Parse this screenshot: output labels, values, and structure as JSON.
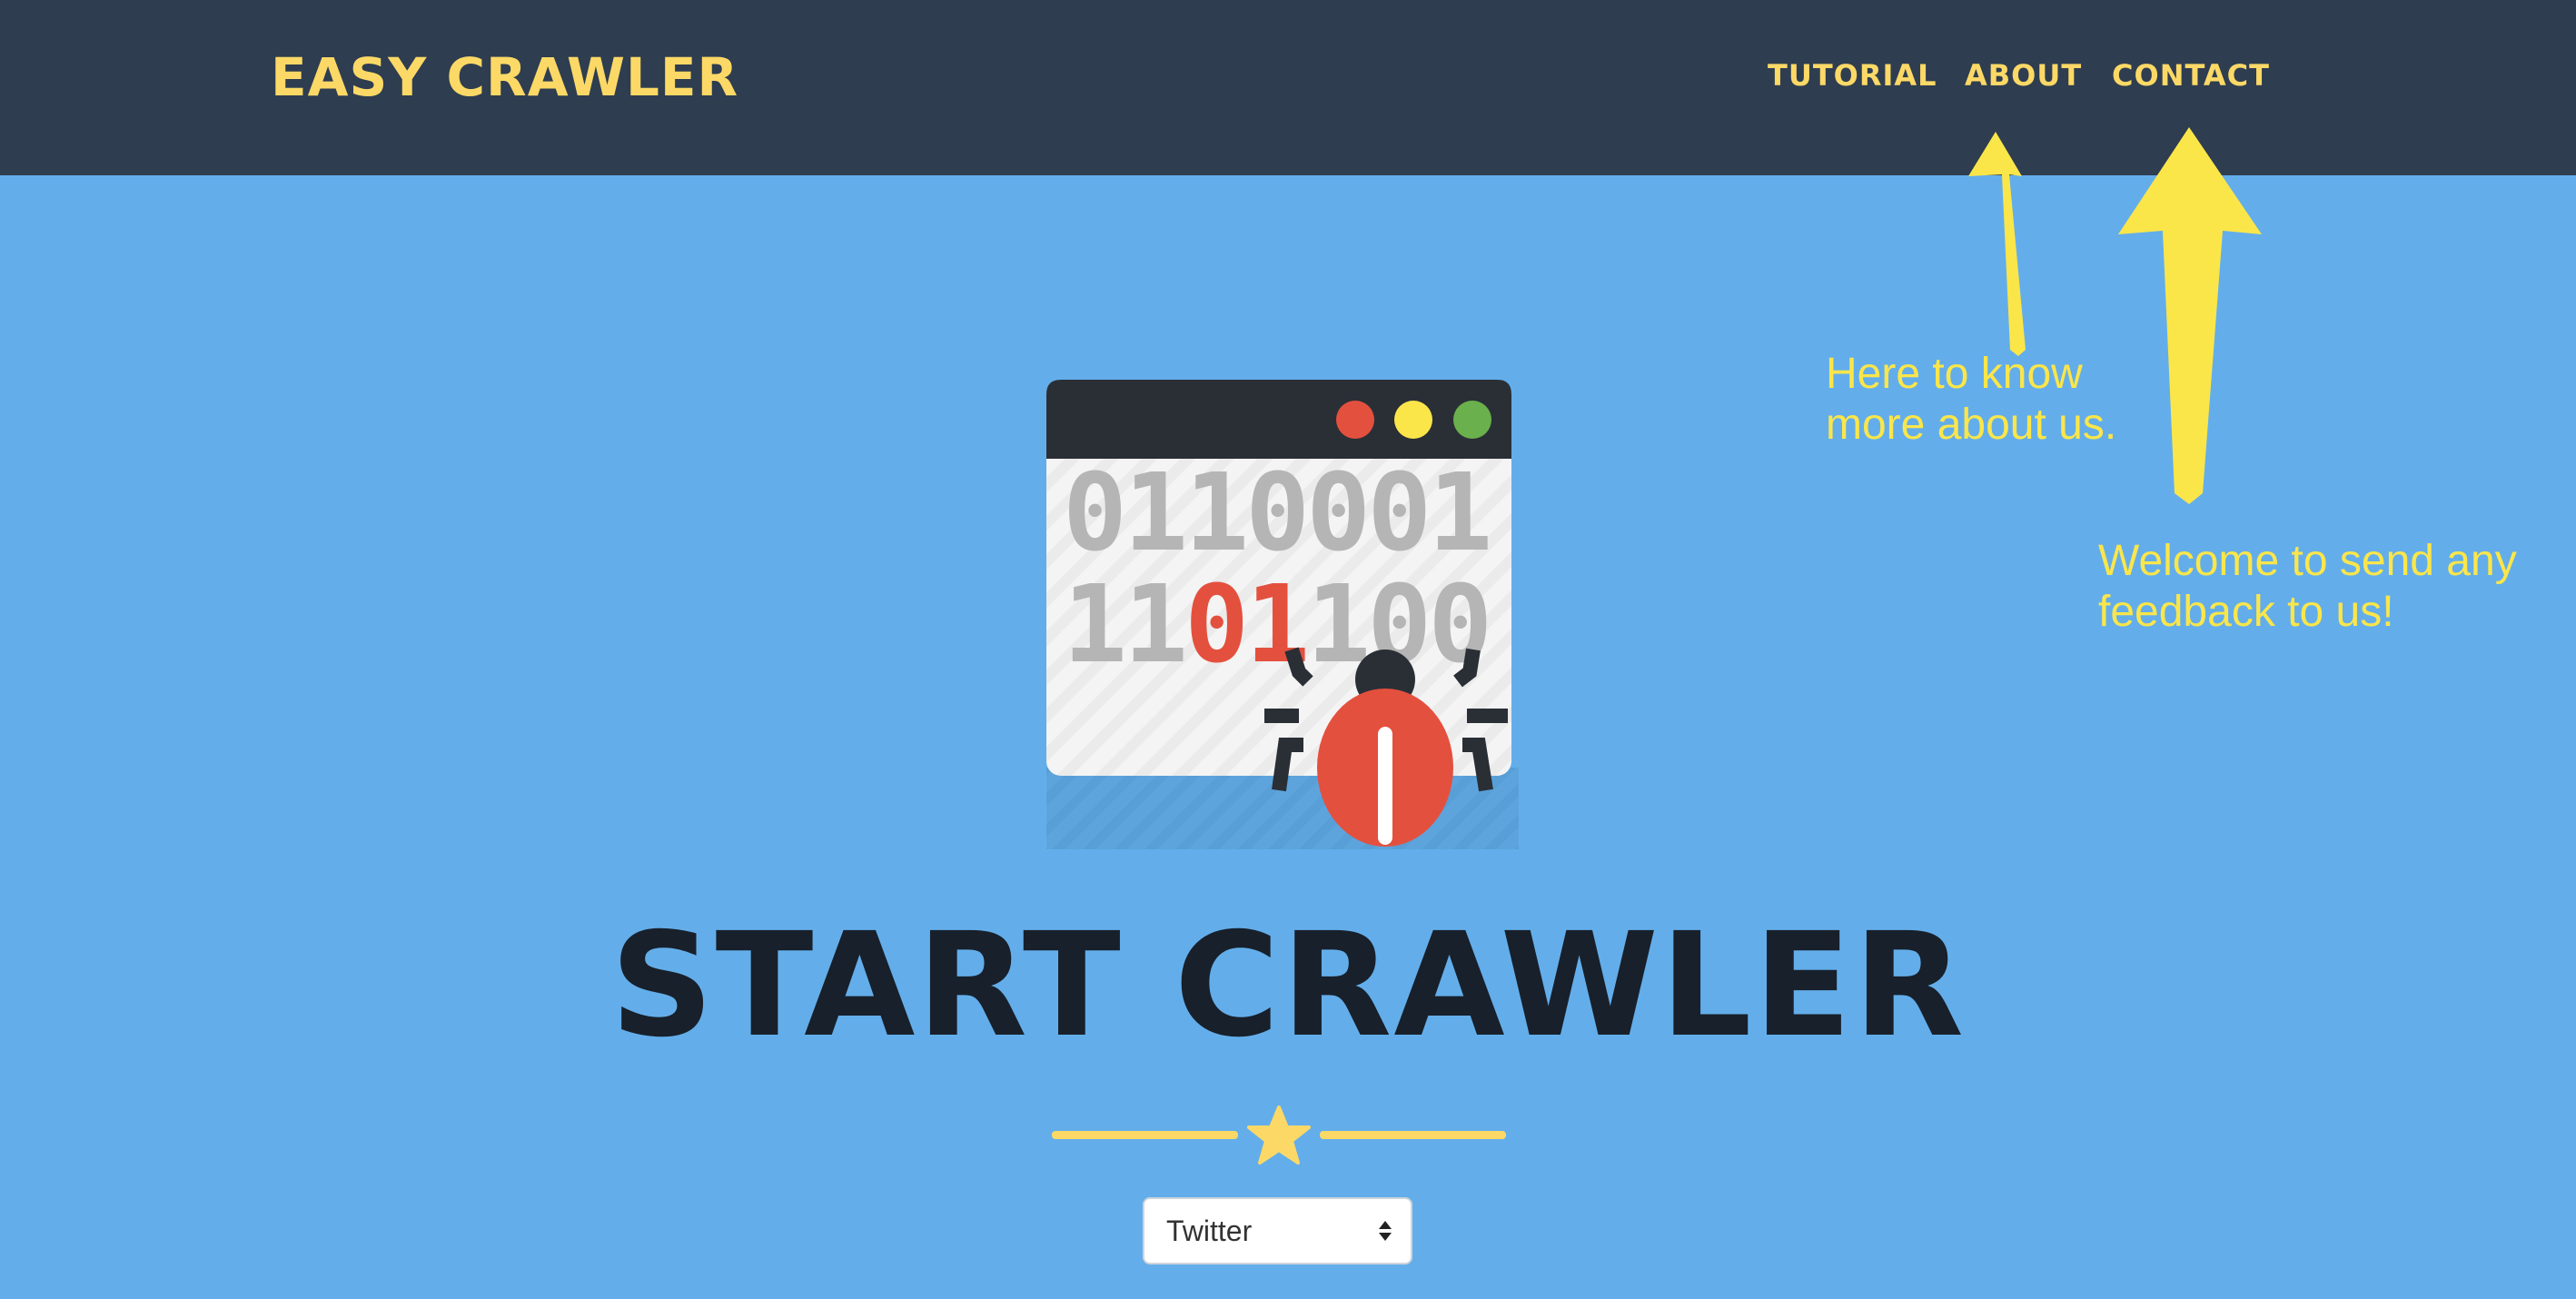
{
  "navbar": {
    "brand": "EASY CRAWLER",
    "links": [
      {
        "label": "TUTORIAL"
      },
      {
        "label": "ABOUT"
      },
      {
        "label": "CONTACT"
      }
    ]
  },
  "annotations": {
    "about_note": [
      "Here to know",
      "more about us."
    ],
    "contact_note": [
      "Welcome to send any",
      "feedback to us!"
    ]
  },
  "hero": {
    "icon": "browser-bug-icon",
    "binary_row_1": "0110001",
    "binary_row_2_pre": "11",
    "binary_row_2_highlight": "01",
    "binary_row_2_post": "100",
    "title": "START CRAWLER",
    "divider_icon": "star-icon"
  },
  "crawler_select": {
    "selected": "Twitter"
  },
  "colors": {
    "background": "#63aeea",
    "navbar": "#2e3d50",
    "accent": "#fcd966",
    "annotation": "#fbe64a",
    "title": "#18202b",
    "bug_red": "#e4503e"
  }
}
